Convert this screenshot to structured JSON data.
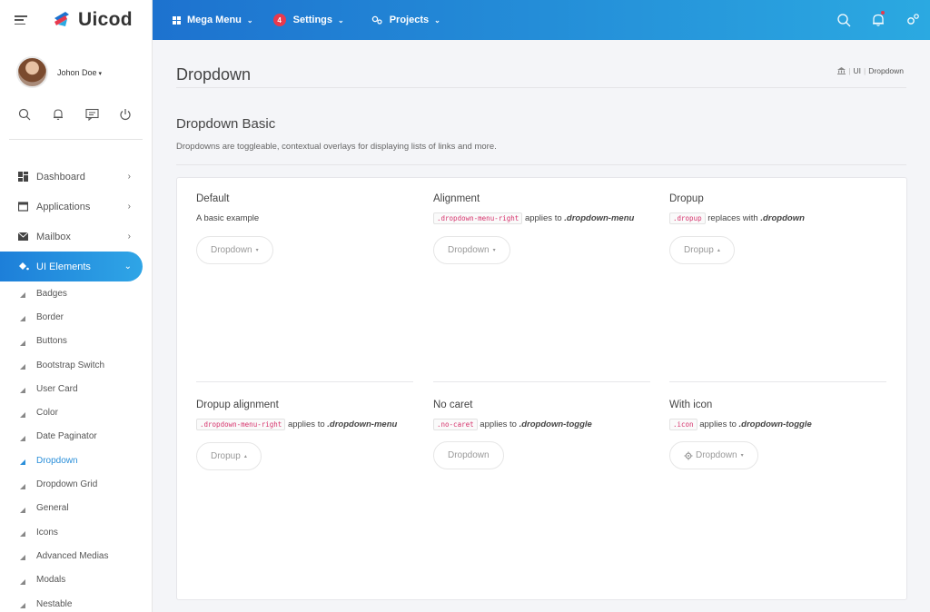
{
  "brand": {
    "name": "Uicod"
  },
  "user": {
    "name": "Johon Doe",
    "caret": "▾"
  },
  "topbar": {
    "mega_menu": "Mega Menu",
    "settings": "Settings",
    "settings_badge": "4",
    "projects": "Projects",
    "chevron": "⌄"
  },
  "sidebar": {
    "chev_right": "›",
    "chev_down": "⌄",
    "items": [
      {
        "label": "Dashboard"
      },
      {
        "label": "Applications"
      },
      {
        "label": "Mailbox"
      },
      {
        "label": "UI Elements"
      }
    ],
    "subitems": [
      {
        "label": "Badges"
      },
      {
        "label": "Border"
      },
      {
        "label": "Buttons"
      },
      {
        "label": "Bootstrap Switch"
      },
      {
        "label": "User Card"
      },
      {
        "label": "Color"
      },
      {
        "label": "Date Paginator"
      },
      {
        "label": "Dropdown"
      },
      {
        "label": "Dropdown Grid"
      },
      {
        "label": "General"
      },
      {
        "label": "Icons"
      },
      {
        "label": "Advanced Medias"
      },
      {
        "label": "Modals"
      },
      {
        "label": "Nestable"
      }
    ]
  },
  "page": {
    "title": "Dropdown",
    "breadcrumb": {
      "sep": "|",
      "ui": "UI",
      "current": "Dropdown"
    },
    "section_title": "Dropdown Basic",
    "section_desc": "Dropdowns are toggleable, contextual overlays for displaying lists of links and more."
  },
  "examples": {
    "caret": "▾",
    "caret_up": "▴",
    "default": {
      "title": "Default",
      "desc": "A basic example",
      "button": "Dropdown"
    },
    "alignment": {
      "title": "Alignment",
      "code": ".dropdown-menu-right",
      "text": "applies to",
      "target": ".dropdown-menu",
      "button": "Dropdown"
    },
    "dropup": {
      "title": "Dropup",
      "code": ".dropup",
      "text": "replaces with",
      "target": ".dropdown",
      "button": "Dropup"
    },
    "dropup_alignment": {
      "title": "Dropup alignment",
      "code": ".dropdown-menu-right",
      "text": "applies to",
      "target": ".dropdown-menu",
      "button": "Dropup"
    },
    "no_caret": {
      "title": "No caret",
      "code": ".no-caret",
      "text": "applies to",
      "target": ".dropdown-toggle",
      "button": "Dropdown"
    },
    "with_icon": {
      "title": "With icon",
      "code": ".icon",
      "text": "applies to",
      "target": ".dropdown-toggle",
      "button": "Dropdown"
    }
  },
  "colors": {
    "accent": "#2a8fd9",
    "topbar_start": "#1d72cf",
    "topbar_end": "#2ba9e1",
    "badge": "#e8394d",
    "code": "#d6336c"
  }
}
